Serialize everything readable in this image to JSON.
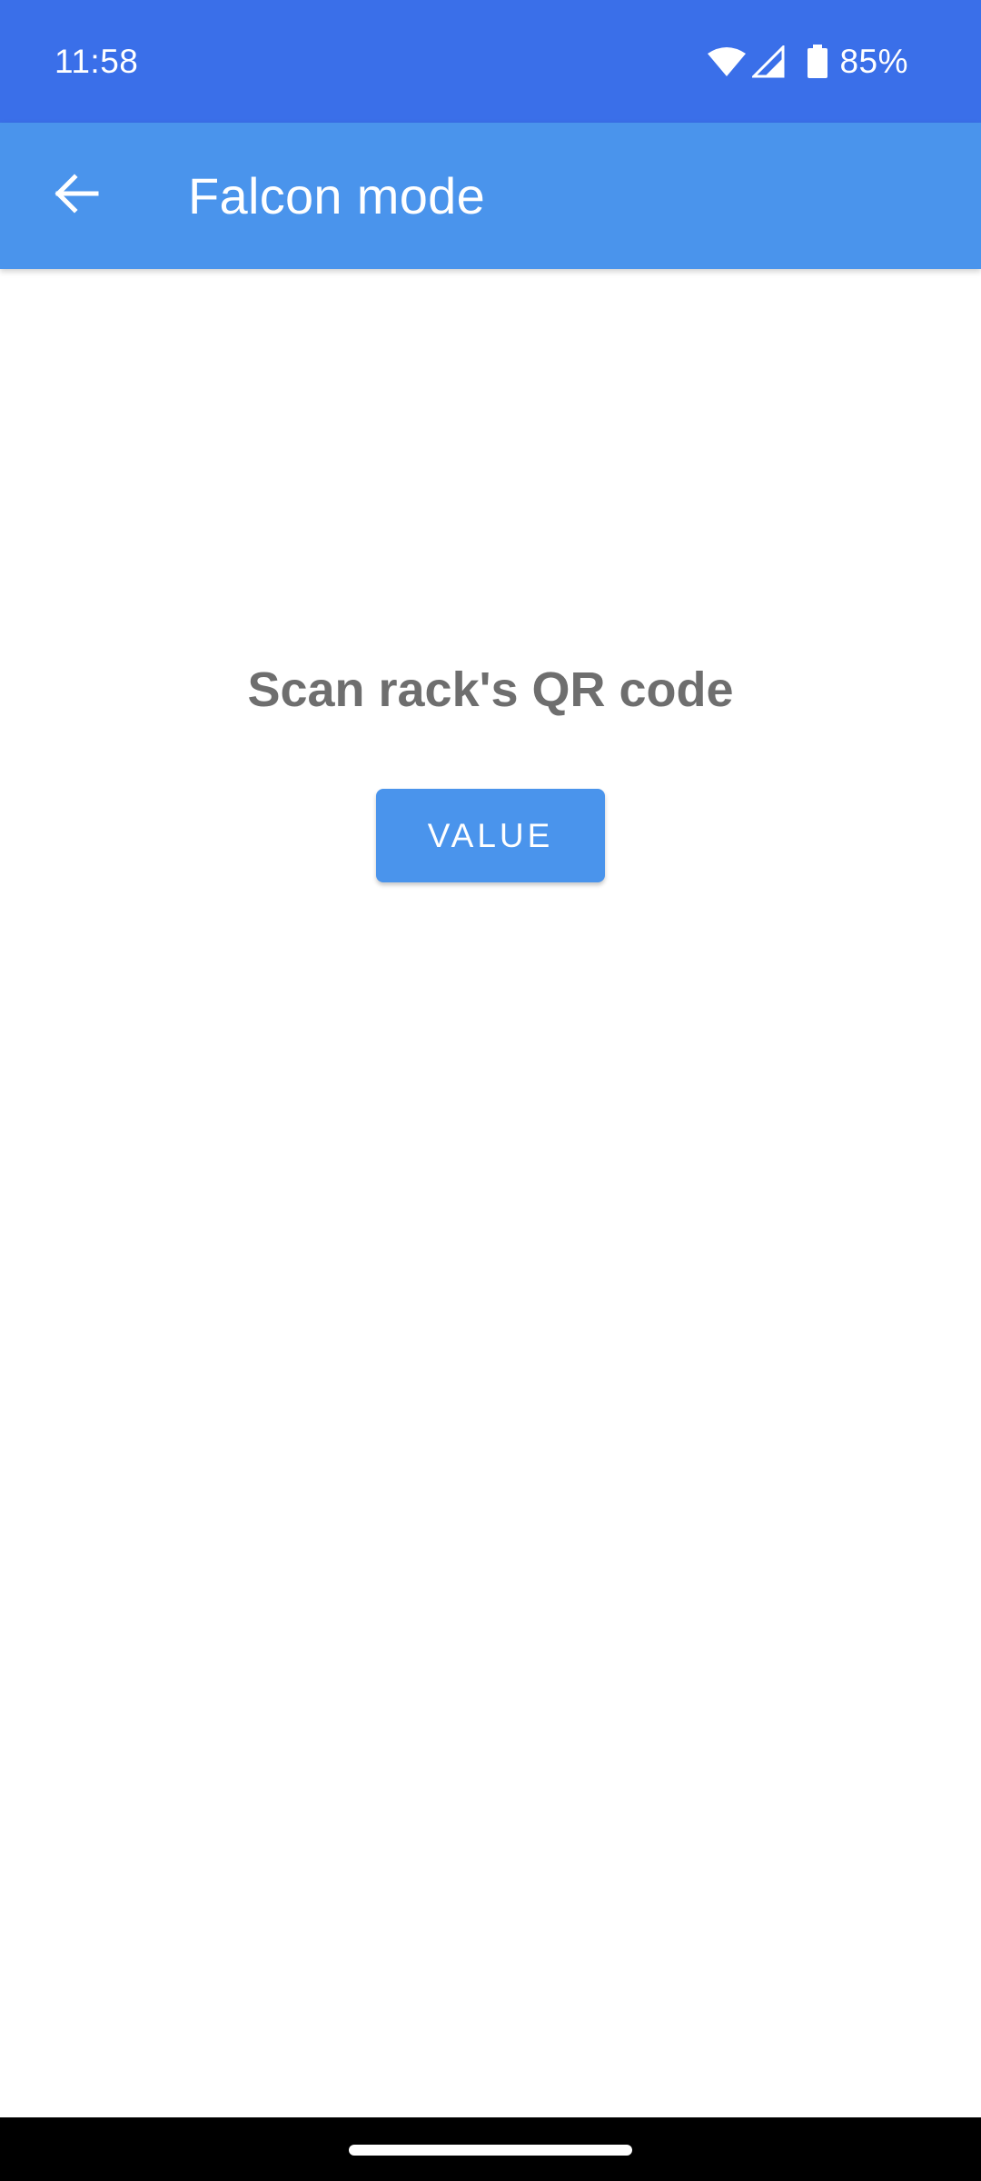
{
  "status_bar": {
    "time": "11:58",
    "battery_percent": "85%",
    "icons": [
      "wifi-icon",
      "cell-signal-icon",
      "battery-icon"
    ],
    "background": "#3a6fe9"
  },
  "app_bar": {
    "title": "Falcon mode",
    "back_icon": "arrow-back-icon",
    "background": "#4a94ec"
  },
  "main": {
    "prompt": "Scan rack's QR code",
    "button_label": "VALUE",
    "button_color": "#4a94ec",
    "prompt_color": "#6e6e6e"
  },
  "nav_bar": {
    "background": "#000000",
    "handle": "gesture-home-handle"
  }
}
